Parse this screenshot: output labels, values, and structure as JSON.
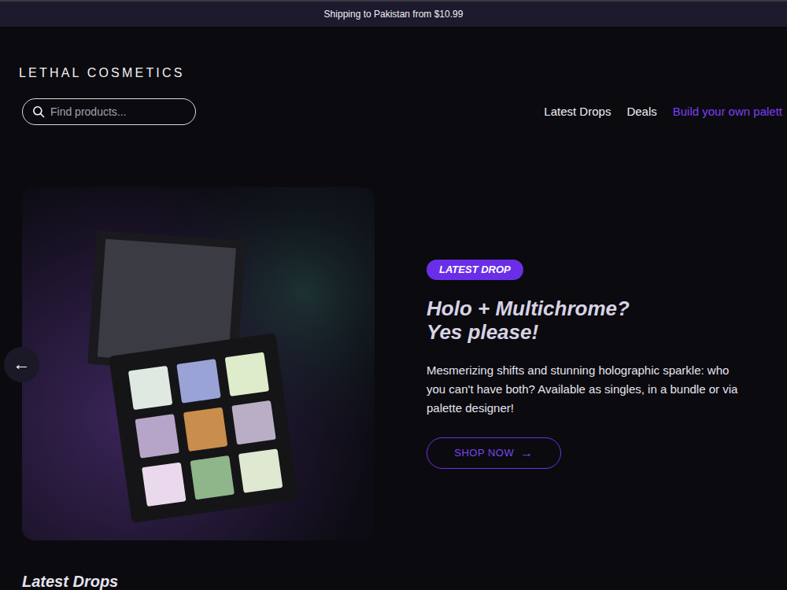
{
  "announcement": {
    "text": "Shipping to Pakistan from $10.99"
  },
  "header": {
    "logo": "LETHAL COSMETICS",
    "search": {
      "placeholder": "Find products..."
    },
    "nav": [
      {
        "label": "Latest Drops",
        "highlighted": false
      },
      {
        "label": "Deals",
        "highlighted": false
      },
      {
        "label": "Build your own palett",
        "highlighted": true
      }
    ]
  },
  "hero": {
    "prev_button": "←",
    "badge": "LATEST DROP",
    "title_lines": [
      "Holo + Multichrome?",
      "Yes please!"
    ],
    "description_lines": [
      "Mesmerizing shifts and stunning holographic sparkle: who",
      "you can't have both? Available as singles, in a bundle or via",
      "palette designer!"
    ],
    "cta": {
      "label": "SHOP NOW",
      "arrow": "→"
    }
  },
  "sections": [
    {
      "title": "Latest Drops"
    }
  ]
}
